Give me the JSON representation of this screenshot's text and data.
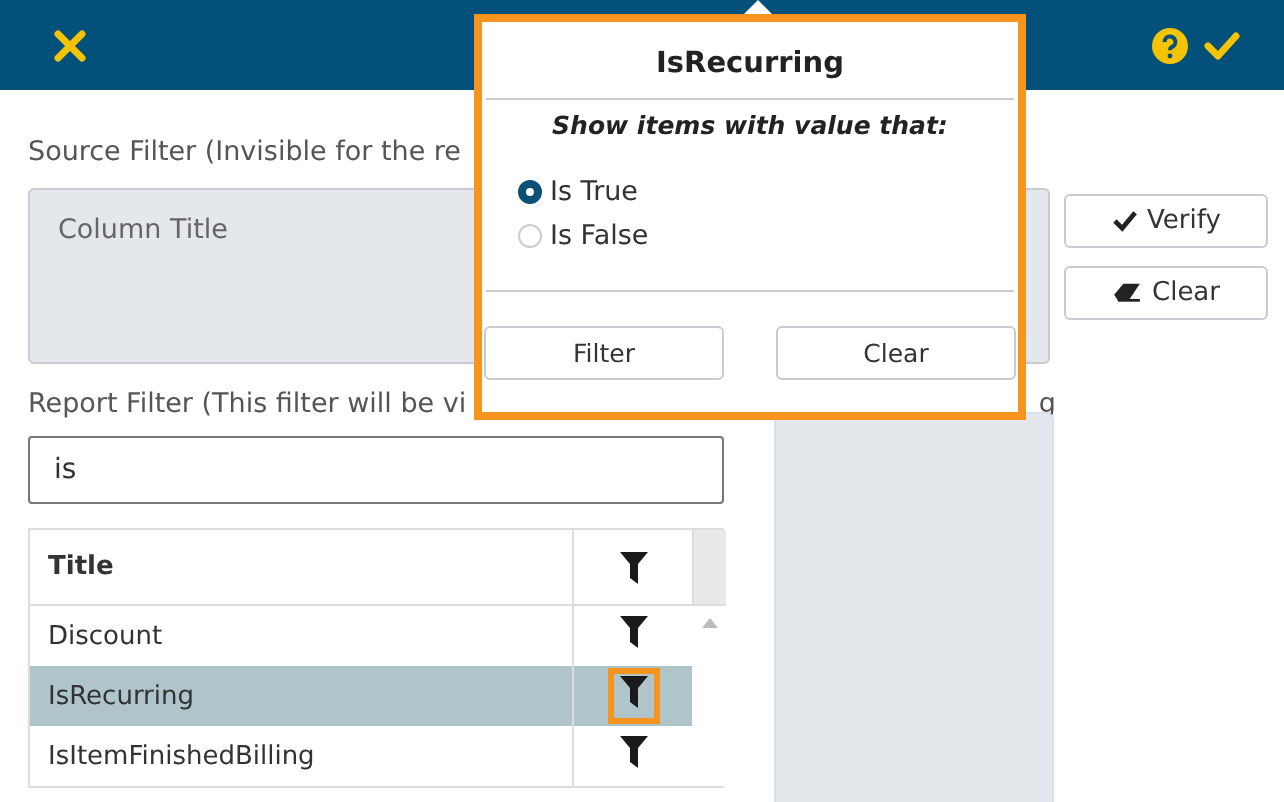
{
  "source_filter": {
    "label": "Source Filter (Invisible for the re",
    "placeholder": "Column Title"
  },
  "side_buttons": [
    {
      "kind": "verify",
      "label": "Verify"
    },
    {
      "kind": "clear",
      "label": "Clear"
    }
  ],
  "report_filter": {
    "label": "Report Filter (This filter will be vi",
    "label_tail": "g"
  },
  "search": {
    "value": "is"
  },
  "table": {
    "columns": [
      "Title"
    ],
    "rows": [
      {
        "title": "Discount",
        "selected": false,
        "filter_highlighted": false
      },
      {
        "title": "IsRecurring",
        "selected": true,
        "filter_highlighted": true
      },
      {
        "title": "IsItemFinishedBilling",
        "selected": false,
        "filter_highlighted": false
      }
    ]
  },
  "popup": {
    "title": "IsRecurring",
    "subtitle": "Show items with value that:",
    "options": [
      {
        "label": "Is True",
        "selected": true
      },
      {
        "label": "Is False",
        "selected": false
      }
    ],
    "buttons": [
      "Filter",
      "Clear"
    ]
  }
}
